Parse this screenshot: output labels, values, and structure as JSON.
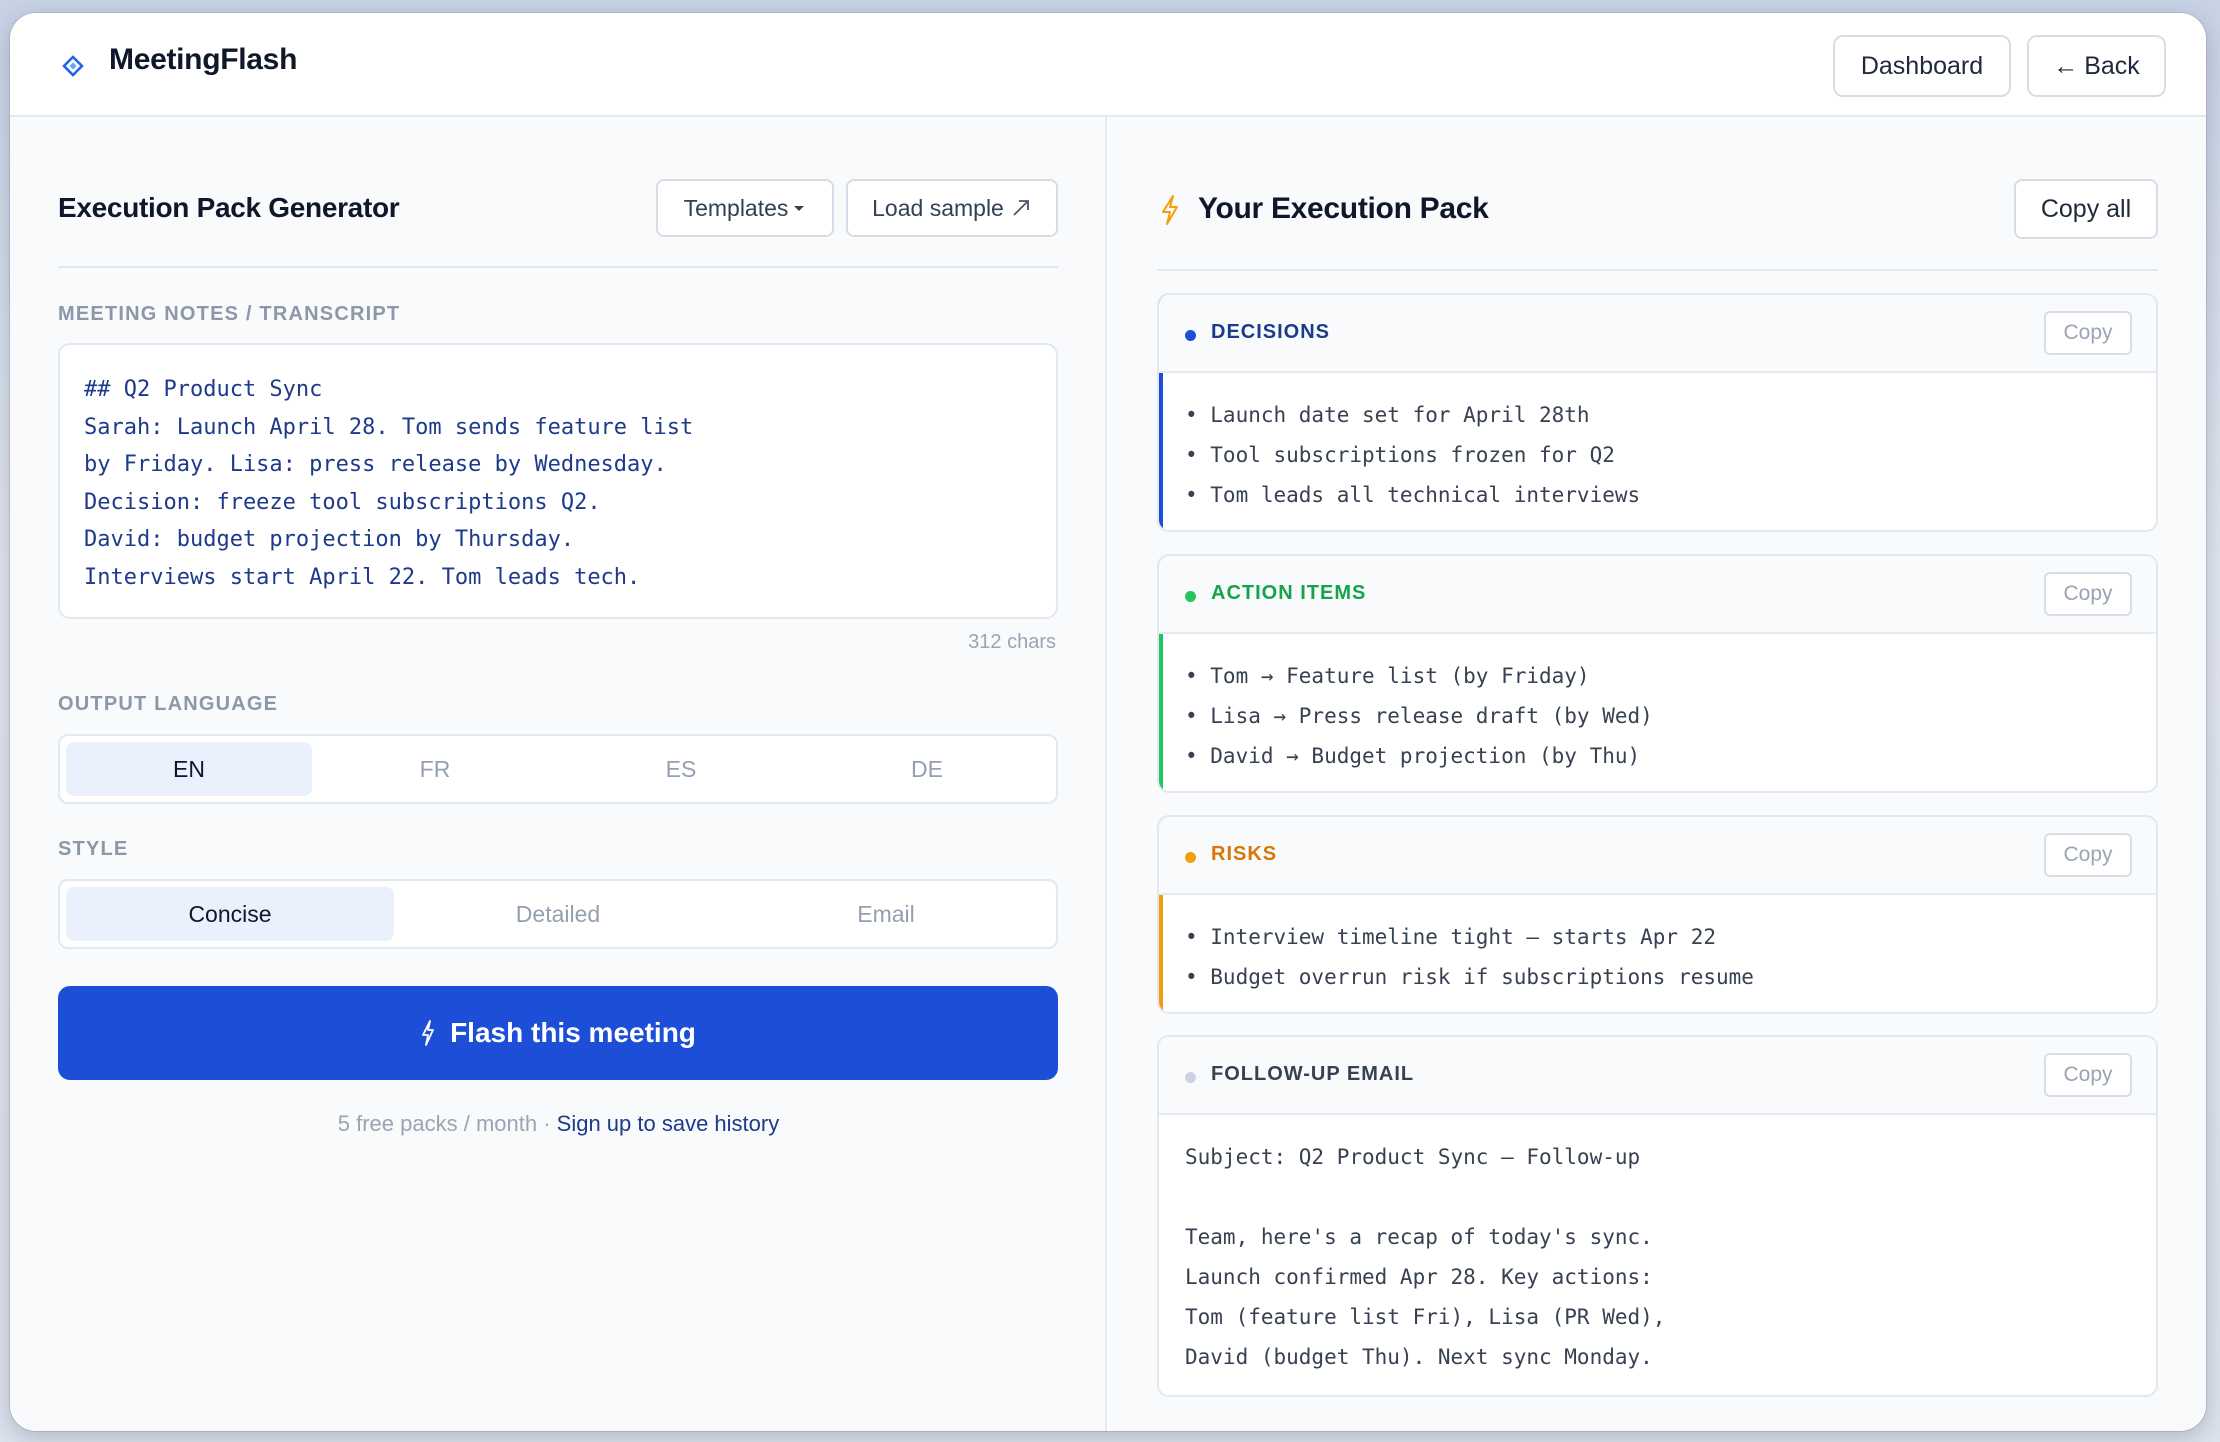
{
  "app": {
    "title": "MeetingFlash"
  },
  "topnav": {
    "dashboard_label": "Dashboard",
    "back_label": "Back",
    "back_arrow": "←"
  },
  "left": {
    "title": "Execution Pack Generator",
    "templates_label": "Templates",
    "load_sample_label": "Load sample",
    "notes_label": "MEETING NOTES / TRANSCRIPT",
    "notes_lines": [
      "## Q2 Product Sync",
      "Sarah: Launch April 28. Tom sends feature list",
      "by Friday. Lisa: press release by Wednesday.",
      "Decision: freeze tool subscriptions Q2.",
      "David: budget projection by Thursday.",
      "Interviews start April 22. Tom leads tech."
    ],
    "char_count": "312 chars",
    "language_label": "OUTPUT LANGUAGE",
    "languages": [
      "EN",
      "FR",
      "ES",
      "DE"
    ],
    "selected_language": "EN",
    "style_label": "STYLE",
    "styles": [
      "Concise",
      "Detailed",
      "Email"
    ],
    "selected_style": "Concise",
    "flash_label": "Flash this meeting",
    "footnote_text": "5 free packs / month · ",
    "footnote_link": "Sign up to save history"
  },
  "right": {
    "title": "Your Execution Pack",
    "copy_all_label": "Copy all",
    "copy_label": "Copy",
    "decisions": {
      "title": "DECISIONS",
      "color": "#1d4ed8",
      "items": [
        "• Launch date set for April 28th",
        "• Tool subscriptions frozen for Q2",
        "• Tom leads all technical interviews"
      ]
    },
    "action_items": {
      "title": "ACTION ITEMS",
      "color": "#22c55e",
      "items": [
        "• Tom → Feature list (by Friday)",
        "• Lisa → Press release draft (by Wed)",
        "• David → Budget projection (by Thu)"
      ]
    },
    "risks": {
      "title": "RISKS",
      "color": "#f59e0b",
      "items": [
        "• Interview timeline tight — starts Apr 22",
        "• Budget overrun risk if subscriptions resume"
      ]
    },
    "follow_up": {
      "title": "FOLLOW-UP EMAIL",
      "color": "#cbd5e1",
      "lines": [
        "Subject: Q2 Product Sync — Follow-up",
        "",
        "Team, here's a recap of today's sync.",
        "Launch confirmed Apr 28. Key actions:",
        "Tom (feature list Fri), Lisa (PR Wed),",
        "David (budget Thu). Next sync Monday."
      ]
    }
  },
  "colors": {
    "accent": "#1d4ed8",
    "text_dark": "#0f172a",
    "muted": "#94a0b0"
  }
}
